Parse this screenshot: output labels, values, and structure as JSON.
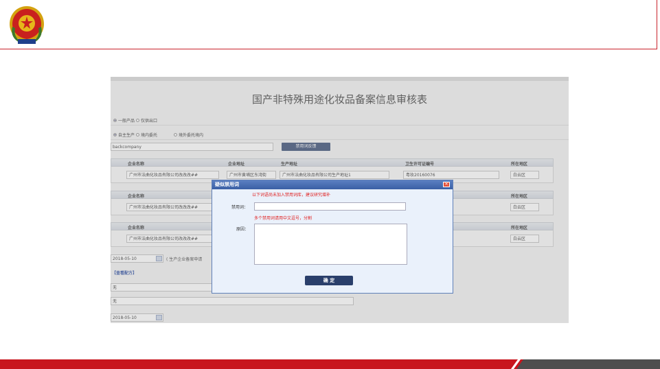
{
  "header": {
    "emblem_icon": "national-emblem-icon"
  },
  "form": {
    "title": "国产非特殊用途化妆品备案信息审核表",
    "product_type": {
      "options": [
        "一般产品",
        "仅供出口"
      ],
      "selected": 0
    },
    "production_mode": {
      "options": [
        "自主生产",
        "境内委托",
        "境外委托境内"
      ],
      "selected": 0
    },
    "company_input": {
      "value": "backcompany"
    },
    "banned_word_button": "禁用词反馈",
    "columns": {
      "company_name": "企业名称",
      "company_address": "企业地址",
      "production_address": "生产地址",
      "license_no": "卫生许可证编号",
      "region": "所在地区"
    },
    "rows": [
      {
        "company_name": "广州市法曲化妆品有限公司改改改##",
        "company_address": "广州市黄埔区东湾街",
        "production_address": "广州市法曲化妆品有限公司生产地址1",
        "license_no": "粤妆20160076",
        "region": "白云区"
      },
      {
        "company_name": "广州市法曲化妆品有限公司改改改##",
        "region": "白云区"
      },
      {
        "company_name": "广州市法曲化妆品有限公司改改改##",
        "region": "白云区"
      }
    ],
    "date1": "2018-05-10",
    "date1_note": "( 生产企业备案申请",
    "view_formula_link": "【查看配方】",
    "field_none_1": "无",
    "field_none_2": "无",
    "date2": "2018-05-10"
  },
  "dialog": {
    "title": "疑似禁用词",
    "notice": "以下词语尚未加入禁用词库，建议研究增补",
    "banned_word_label": "禁用词：",
    "banned_word_hint": "多个禁用词请用中文逗号，分割",
    "reason_label": "原因：",
    "confirm_button": "确 定"
  }
}
